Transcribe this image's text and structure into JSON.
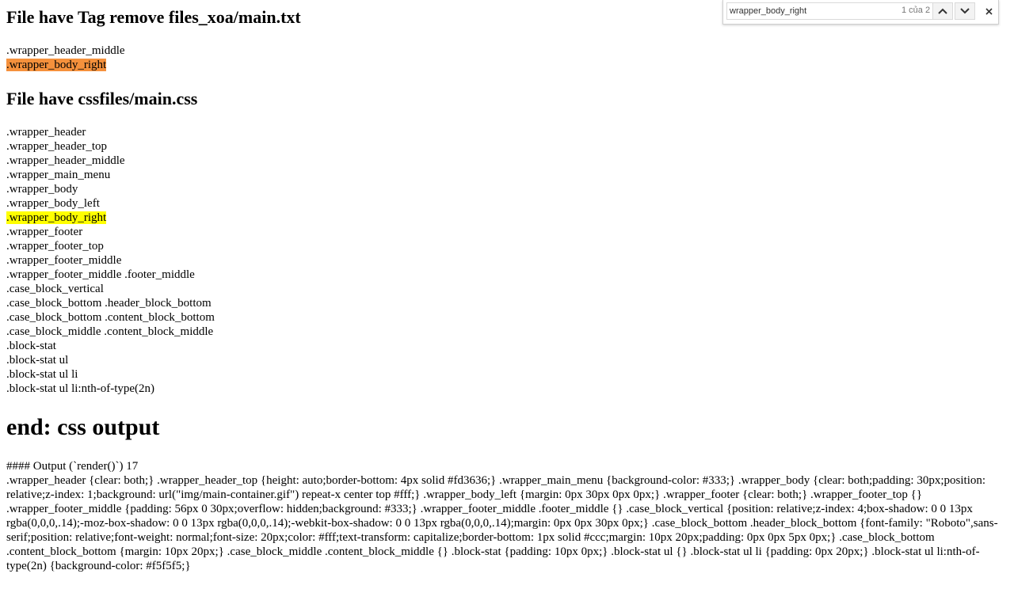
{
  "heading1": "File have Tag remove files_xoa/main.txt",
  "list1": [
    ".wrapper_header_middle",
    ".wrapper_body_right"
  ],
  "heading2": "File have cssfiles/main.css",
  "list2": [
    ".wrapper_header",
    ".wrapper_header_top",
    ".wrapper_header_middle",
    ".wrapper_main_menu",
    ".wrapper_body",
    ".wrapper_body_left",
    ".wrapper_body_right",
    ".wrapper_footer",
    ".wrapper_footer_top",
    ".wrapper_footer_middle",
    ".wrapper_footer_middle .footer_middle",
    ".case_block_vertical",
    ".case_block_bottom .header_block_bottom",
    ".case_block_bottom .content_block_bottom",
    ".case_block_middle .content_block_middle",
    ".block-stat",
    ".block-stat ul",
    ".block-stat ul li",
    ".block-stat ul li:nth-of-type(2n)"
  ],
  "heading3": "end: css output",
  "output_title": "#### Output (`render()`) 17",
  "output_css": ".wrapper_header {clear: both;} .wrapper_header_top {height: auto;border-bottom: 4px solid #fd3636;} .wrapper_main_menu {background-color: #333;} .wrapper_body {clear: both;padding: 30px;position: relative;z-index: 1;background: url(\"img/main-container.gif\") repeat-x center top #fff;} .wrapper_body_left {margin: 0px 30px 0px 0px;} .wrapper_footer {clear: both;} .wrapper_footer_top {} .wrapper_footer_middle {padding: 56px 0 30px;overflow: hidden;background: #333;} .wrapper_footer_middle .footer_middle {} .case_block_vertical {position: relative;z-index: 4;box-shadow: 0 0 13px rgba(0,0,0,.14);-moz-box-shadow: 0 0 13px rgba(0,0,0,.14);-webkit-box-shadow: 0 0 13px rgba(0,0,0,.14);margin: 0px 0px 30px 0px;} .case_block_bottom .header_block_bottom {font-family: \"Roboto\",sans-serif;position: relative;font-weight: normal;font-size: 20px;color: #fff;text-transform: capitalize;border-bottom: 1px solid #ccc;margin: 10px 20px;padding: 0px 0px 5px 0px;} .case_block_bottom .content_block_bottom {margin: 10px 20px;} .case_block_middle .content_block_middle {} .block-stat {padding: 10px 0px;} .block-stat ul {} .block-stat ul li {padding: 0px 20px;} .block-stat ul li:nth-of-type(2n) {background-color: #f5f5f5;}",
  "findbar": {
    "query": "wrapper_body_right",
    "count": "1 của 2",
    "up_icon": "chevron-up-icon",
    "down_icon": "chevron-down-icon",
    "close_icon": "close-icon"
  },
  "colors": {
    "current_match": "#f5913c",
    "other_match": "#ffff00"
  }
}
